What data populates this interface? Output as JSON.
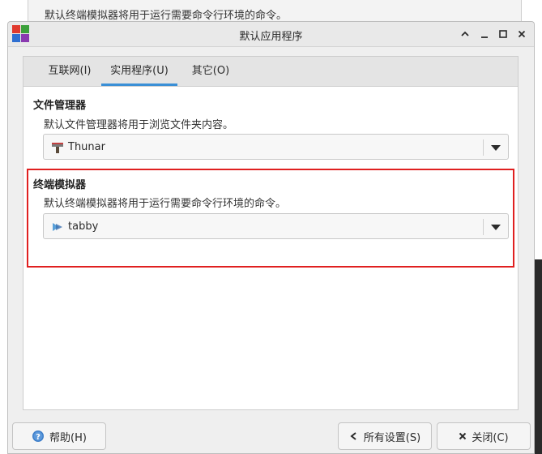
{
  "background_window": {
    "text": "默认终端模拟器将用于运行需要命令行环境的命令。"
  },
  "window": {
    "title": "默认应用程序",
    "controls": [
      "collapse-icon",
      "minimize-icon",
      "maximize-icon",
      "close-icon"
    ]
  },
  "tabs": [
    {
      "label": "互联网(I)",
      "active": false
    },
    {
      "label": "实用程序(U)",
      "active": true
    },
    {
      "label": "其它(O)",
      "active": false
    }
  ],
  "file_manager": {
    "title": "文件管理器",
    "description": "默认文件管理器将用于浏览文件夹内容。",
    "selected": "Thunar",
    "icon": "thunar-icon"
  },
  "terminal": {
    "title": "终端模拟器",
    "description": "默认终端模拟器将用于运行需要命令行环境的命令。",
    "selected": "tabby",
    "icon": "tabby-icon"
  },
  "buttons": {
    "help": "帮助(H)",
    "all_settings": "所有设置(S)",
    "close": "关闭(C)"
  },
  "colors": {
    "accent": "#3a8fd6",
    "highlight": "#e02020"
  }
}
